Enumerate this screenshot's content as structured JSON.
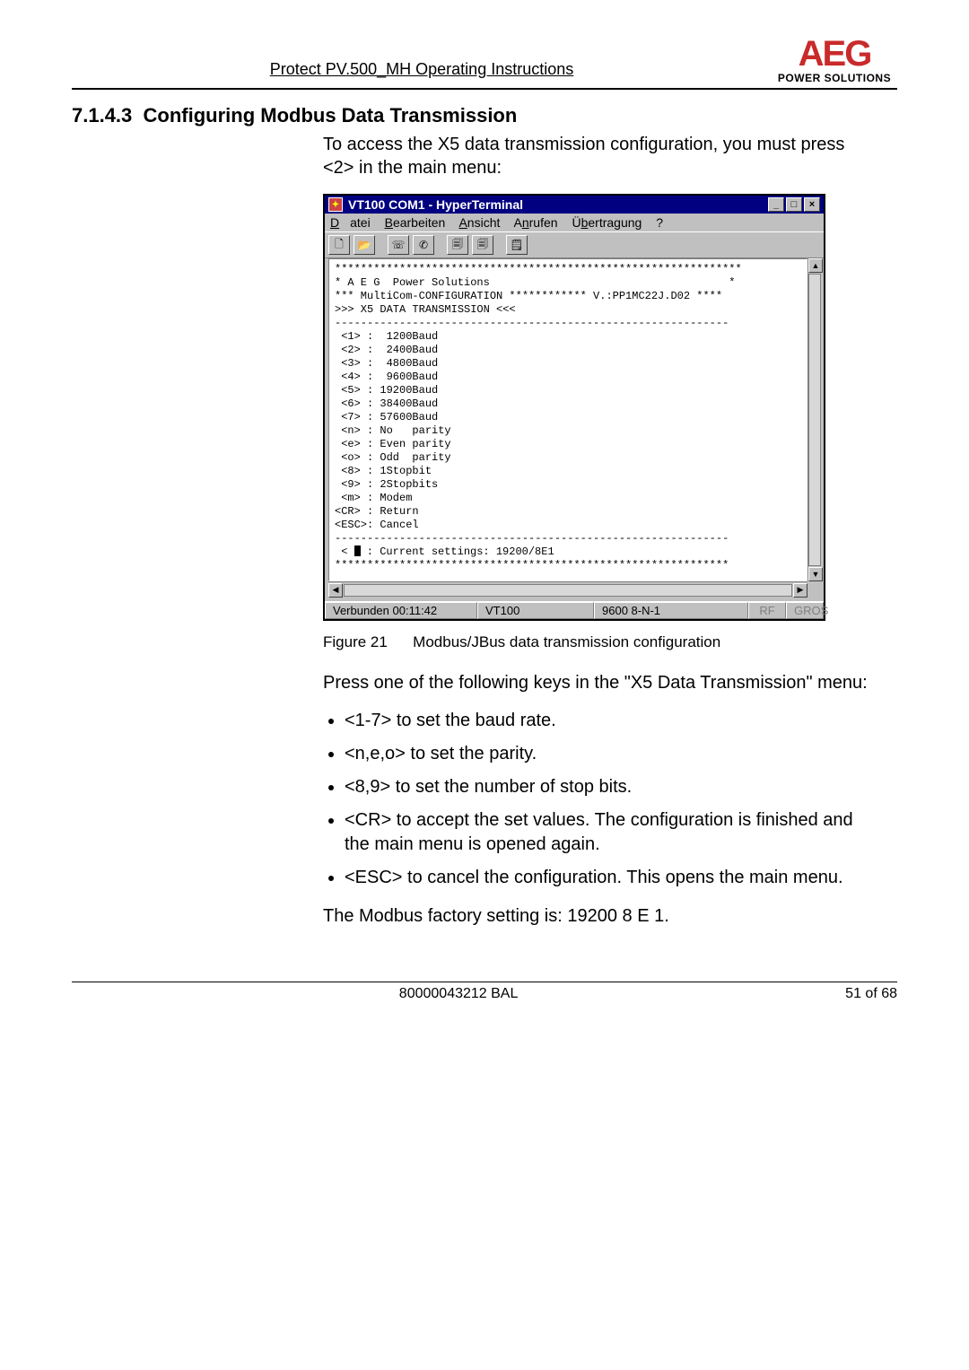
{
  "header": {
    "running_title": "Protect PV.500_MH Operating Instructions",
    "logo_brand": "AEG",
    "logo_tag": "POWER SOLUTIONS"
  },
  "section": {
    "number": "7.1.4.3",
    "title": "Configuring Modbus Data Transmission",
    "intro": "To access the X5 data transmission configuration, you must press <2> in the main menu:"
  },
  "hyperterminal": {
    "title": "VT100 COM1 - HyperTerminal",
    "menu": {
      "m1": "Datei",
      "m2": "Bearbeiten",
      "m3": "Ansicht",
      "m4": "Anrufen",
      "m5": "Übertragung",
      "m6": "?"
    },
    "winbtns": {
      "min": "_",
      "max": "□",
      "close": "×"
    },
    "terminal_text": "***************************************************************\n* A E G  Power Solutions                                     *\n*** MultiCom-CONFIGURATION ************ V.:PP1MC22J.D02 ****\n>>> X5 DATA TRANSMISSION <<<\n-------------------------------------------------------------\n <1> :  1200Baud\n <2> :  2400Baud\n <3> :  4800Baud\n <4> :  9600Baud\n <5> : 19200Baud\n <6> : 38400Baud\n <7> : 57600Baud\n <n> : No   parity\n <e> : Even parity\n <o> : Odd  parity\n <8> : 1Stopbit\n <9> : 2Stopbits\n <m> : Modem\n<CR> : Return\n<ESC>: Cancel\n-------------------------------------------------------------\n < ",
    "current_line": " : Current settings: 19200/8E1",
    "stars": "*************************************************************",
    "status": {
      "conn": "Verbunden 00:11:42",
      "proto": "VT100",
      "rate": "9600 8-N-1",
      "s1": "RF",
      "s2": "GROS"
    }
  },
  "figure": {
    "label": "Figure 21",
    "caption": "Modbus/JBus data transmission configuration"
  },
  "body": {
    "press_one": "Press one of the following keys in the \"X5 Data Transmission\" menu:",
    "bullets": [
      "<1-7> to set the baud rate.",
      "<n,e,o> to set the parity.",
      "<8,9> to set the number of stop bits.",
      "<CR> to accept the set values. The configuration is finished and the main menu is opened again.",
      "<ESC> to cancel the configuration. This opens the main menu."
    ],
    "factory": "The Modbus factory setting is:   19200 8 E 1."
  },
  "footer": {
    "doc_id": "80000043212 BAL",
    "page": "51 of 68"
  }
}
